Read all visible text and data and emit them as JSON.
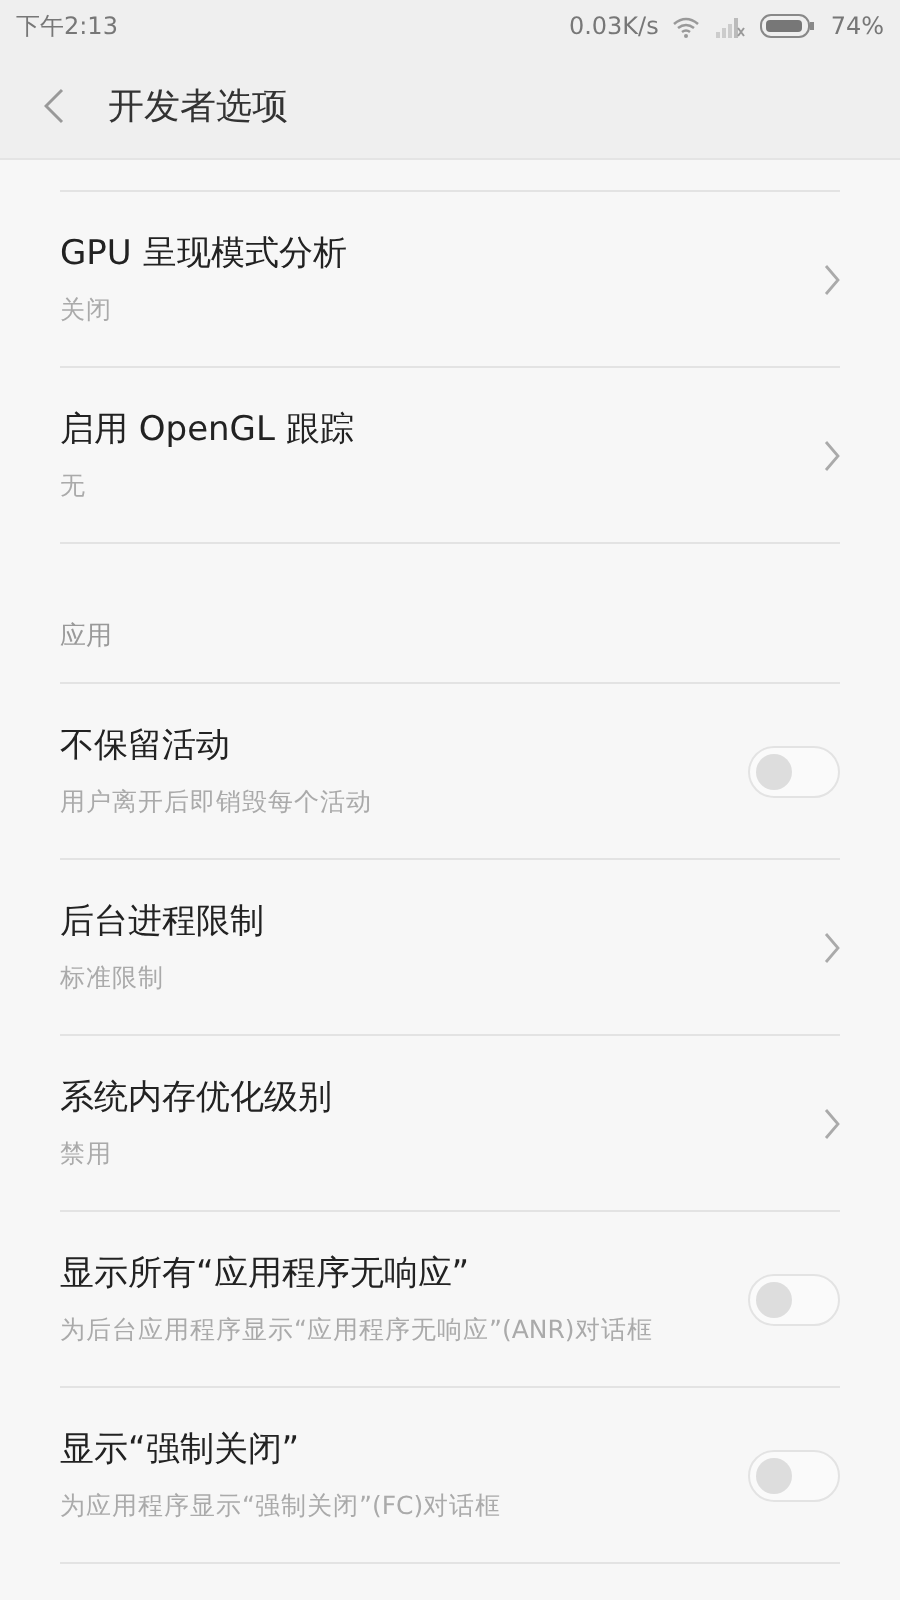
{
  "status_bar": {
    "time": "下午2:13",
    "speed": "0.03K/s",
    "battery": "74%"
  },
  "header": {
    "title": "开发者选项"
  },
  "items": [
    {
      "kind": "link",
      "title": "GPU 呈现模式分析",
      "subtitle": "关闭"
    },
    {
      "kind": "link",
      "title": "启用 OpenGL 跟踪",
      "subtitle": "无"
    },
    {
      "kind": "section",
      "title": "应用"
    },
    {
      "kind": "toggle",
      "title": "不保留活动",
      "subtitle": "用户离开后即销毁每个活动",
      "on": false
    },
    {
      "kind": "link",
      "title": "后台进程限制",
      "subtitle": "标准限制"
    },
    {
      "kind": "link",
      "title": "系统内存优化级别",
      "subtitle": "禁用"
    },
    {
      "kind": "toggle",
      "title": "显示所有“应用程序无响应”",
      "subtitle": "为后台应用程序显示“应用程序无响应”(ANR)对话框",
      "on": false
    },
    {
      "kind": "toggle",
      "title": "显示“强制关闭”",
      "subtitle": "为应用程序显示“强制关闭”(FC)对话框",
      "on": false
    }
  ]
}
